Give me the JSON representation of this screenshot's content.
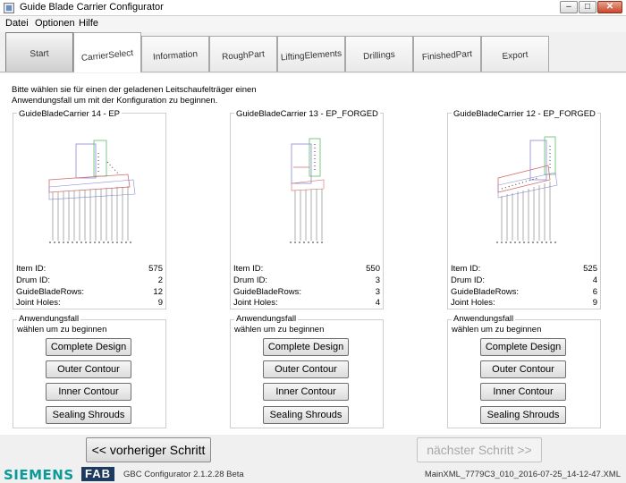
{
  "window": {
    "title": "Guide Blade Carrier Configurator"
  },
  "menu": {
    "items": [
      "Datei",
      "Optionen",
      "Hilfe"
    ]
  },
  "tabs": [
    "Start",
    "CarrierSelect",
    "Information",
    "RoughPart",
    "LiftingElements",
    "Drillings",
    "FinishedPart",
    "Export"
  ],
  "intro": "Bitte wählen sie für einen der geladenen Leitschaufelträger einen Anwendungsfall um mit der Konfiguration zu beginnen.",
  "labels": {
    "item_id": "Item ID:",
    "drum_id": "Drum ID:",
    "rows": "GuideBladeRows:",
    "holes": "Joint Holes:"
  },
  "carriers": [
    {
      "title": "GuideBladeCarrier 14 - EP",
      "item_id": "575",
      "drum_id": "2",
      "rows": "12",
      "holes": "9"
    },
    {
      "title": "GuideBladeCarrier 13 - EP_FORGED",
      "item_id": "550",
      "drum_id": "3",
      "rows": "3",
      "holes": "4"
    },
    {
      "title": "GuideBladeCarrier 12 - EP_FORGED",
      "item_id": "525",
      "drum_id": "4",
      "rows": "6",
      "holes": "9"
    }
  ],
  "usecase": {
    "title": "Anwendungsfall",
    "subtitle": "wählen um zu beginnen",
    "buttons": [
      "Complete Design",
      "Outer Contour",
      "Inner Contour",
      "Sealing Shrouds"
    ]
  },
  "nav": {
    "prev": "<< vorheriger Schritt",
    "next": "nächster Schritt >>"
  },
  "status": {
    "brand": "SIEMENS",
    "logo": "FAB",
    "version": "GBC Configurator 2.1.2.28 Beta",
    "file": "MainXML_7779C3_010_2016-07-25_14-12-47.XML"
  },
  "colors": {
    "siemens_teal": "#0b9a9a",
    "fab_navy": "#1e3a5f"
  }
}
